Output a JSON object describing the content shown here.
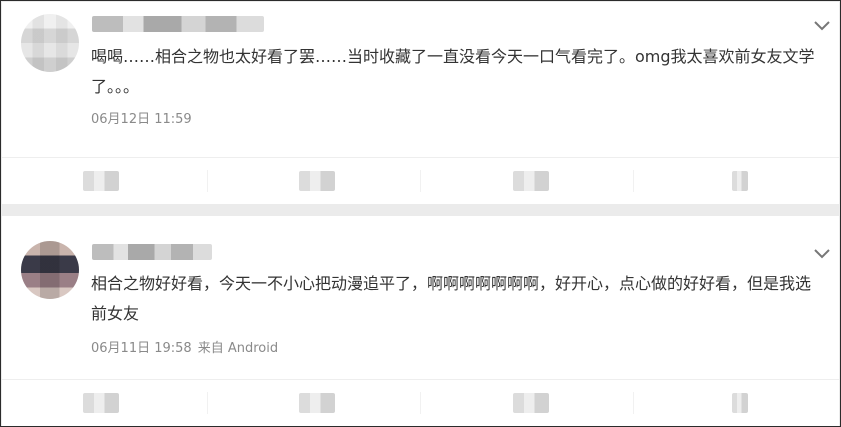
{
  "comments": [
    {
      "text": "喝喝……相合之物也太好看了罢……当时收藏了一直没看今天一口气看完了。omg我太喜欢前女友文学了。。。",
      "time": "06月12日 11:59",
      "source": ""
    },
    {
      "text": "相合之物好好看，今天一不小心把动漫追平了，啊啊啊啊啊啊啊，好开心，点心做的好好看，但是我选前女友",
      "time": "06月11日 19:58",
      "source": "来自 Android"
    }
  ],
  "icons": {
    "expand": "chevron-down-icon",
    "avatar": "avatar-blurred",
    "actions": [
      "forward-icon",
      "comment-icon",
      "like-icon",
      "more-icon"
    ]
  },
  "colors": {
    "text": "#333333",
    "meta": "#8a8a8a",
    "background": "#ebebeb",
    "card": "#ffffff"
  }
}
